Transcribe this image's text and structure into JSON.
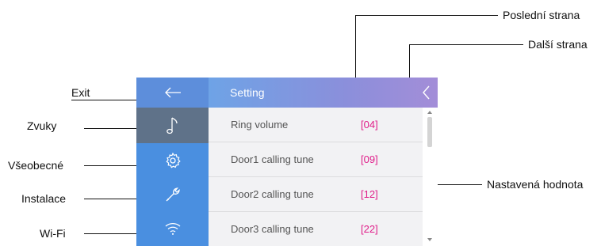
{
  "callouts": {
    "previous_page": "Poslední strana",
    "next_page": "Další strana",
    "exit": "Exit",
    "sounds": "Zvuky",
    "general": "Všeobecné",
    "installation": "Instalace",
    "wifi": "Wi-Fi",
    "set_value": "Nastavená hodnota"
  },
  "screen": {
    "title": "Setting",
    "sidebar_icons": [
      "back-arrow-icon",
      "music-note-icon",
      "gear-icon",
      "wrench-icon",
      "wifi-icon"
    ],
    "rows": [
      {
        "label": "Ring volume",
        "value": "[04]"
      },
      {
        "label": "Door1 calling tune",
        "value": "[09]"
      },
      {
        "label": "Door2 calling tune",
        "value": "[12]"
      },
      {
        "label": "Door3 calling tune",
        "value": "[22]"
      }
    ]
  },
  "colors": {
    "sidebar": "#4a8fe0",
    "sidebar_active": "#5f7289",
    "header_gradient_start": "#6ea3e6",
    "header_gradient_end": "#a38dd8",
    "value_text": "#e01e8a",
    "list_background": "#f2f2f4"
  }
}
